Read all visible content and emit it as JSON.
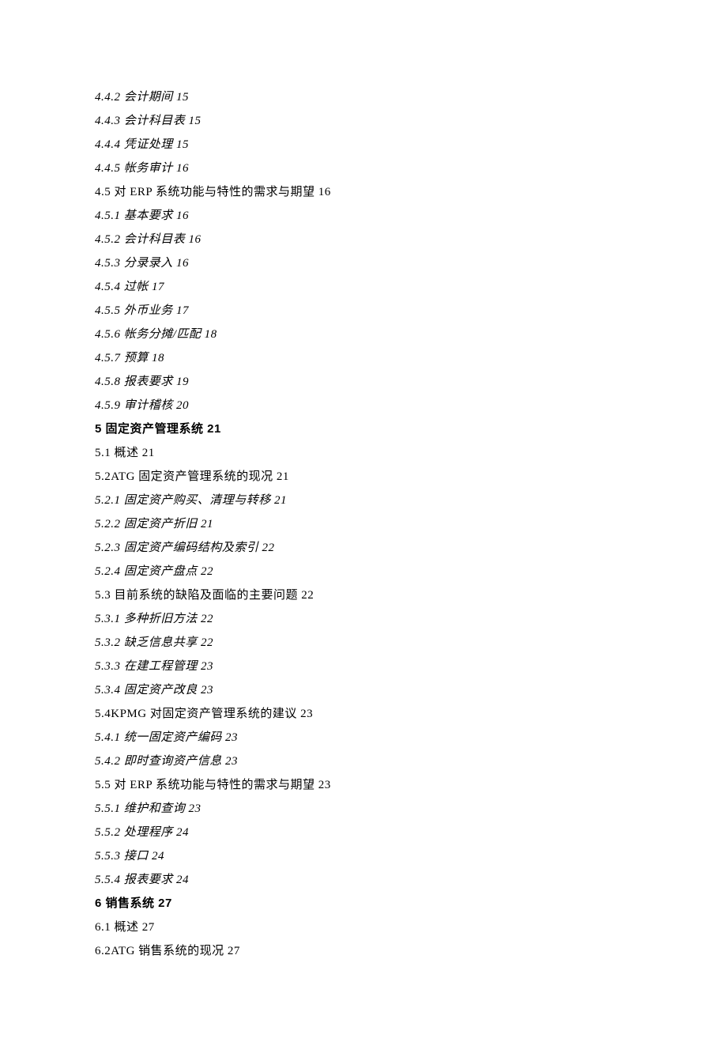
{
  "toc": [
    {
      "text": "4.4.2 会计期间 15",
      "style": "italic"
    },
    {
      "text": "4.4.3 会计科目表 15",
      "style": "italic"
    },
    {
      "text": "4.4.4 凭证处理 15",
      "style": "italic"
    },
    {
      "text": "4.4.5 帐务审计 16",
      "style": "italic"
    },
    {
      "text": "4.5 对 ERP 系统功能与特性的需求与期望 16",
      "style": "normal"
    },
    {
      "text": "4.5.1 基本要求 16",
      "style": "italic"
    },
    {
      "text": "4.5.2 会计科目表 16",
      "style": "italic"
    },
    {
      "text": "4.5.3 分录录入 16",
      "style": "italic"
    },
    {
      "text": "4.5.4 过帐 17",
      "style": "italic"
    },
    {
      "text": "4.5.5 外币业务 17",
      "style": "italic"
    },
    {
      "text": "4.5.6 帐务分摊/匹配 18",
      "style": "italic"
    },
    {
      "text": "4.5.7 预算 18",
      "style": "italic"
    },
    {
      "text": "4.5.8 报表要求 19",
      "style": "italic"
    },
    {
      "text": "4.5.9 审计稽核 20",
      "style": "italic"
    },
    {
      "text": "5 固定资产管理系统 21",
      "style": "bold"
    },
    {
      "text": "5.1 概述 21",
      "style": "normal"
    },
    {
      "text": "5.2ATG 固定资产管理系统的现况 21",
      "style": "normal"
    },
    {
      "text": "5.2.1 固定资产购买、清理与转移 21",
      "style": "italic"
    },
    {
      "text": "5.2.2 固定资产折旧 21",
      "style": "italic"
    },
    {
      "text": "5.2.3 固定资产编码结构及索引 22",
      "style": "italic"
    },
    {
      "text": "5.2.4 固定资产盘点 22",
      "style": "italic"
    },
    {
      "text": "5.3 目前系统的缺陷及面临的主要问题 22",
      "style": "normal"
    },
    {
      "text": "5.3.1 多种折旧方法 22",
      "style": "italic"
    },
    {
      "text": "5.3.2 缺乏信息共享 22",
      "style": "italic"
    },
    {
      "text": "5.3.3 在建工程管理 23",
      "style": "italic"
    },
    {
      "text": "5.3.4 固定资产改良 23",
      "style": "italic"
    },
    {
      "text": "5.4KPMG 对固定资产管理系统的建议 23",
      "style": "normal"
    },
    {
      "text": "5.4.1 统一固定资产编码 23",
      "style": "italic"
    },
    {
      "text": "5.4.2 即时查询资产信息 23",
      "style": "italic"
    },
    {
      "text": "5.5 对 ERP 系统功能与特性的需求与期望 23",
      "style": "normal"
    },
    {
      "text": "5.5.1 维护和查询 23",
      "style": "italic"
    },
    {
      "text": "5.5.2 处理程序 24",
      "style": "italic"
    },
    {
      "text": "5.5.3 接口 24",
      "style": "italic"
    },
    {
      "text": "5.5.4 报表要求 24",
      "style": "italic"
    },
    {
      "text": "6 销售系统 27",
      "style": "bold"
    },
    {
      "text": "6.1 概述 27",
      "style": "normal"
    },
    {
      "text": "6.2ATG 销售系统的现况 27",
      "style": "normal"
    }
  ]
}
